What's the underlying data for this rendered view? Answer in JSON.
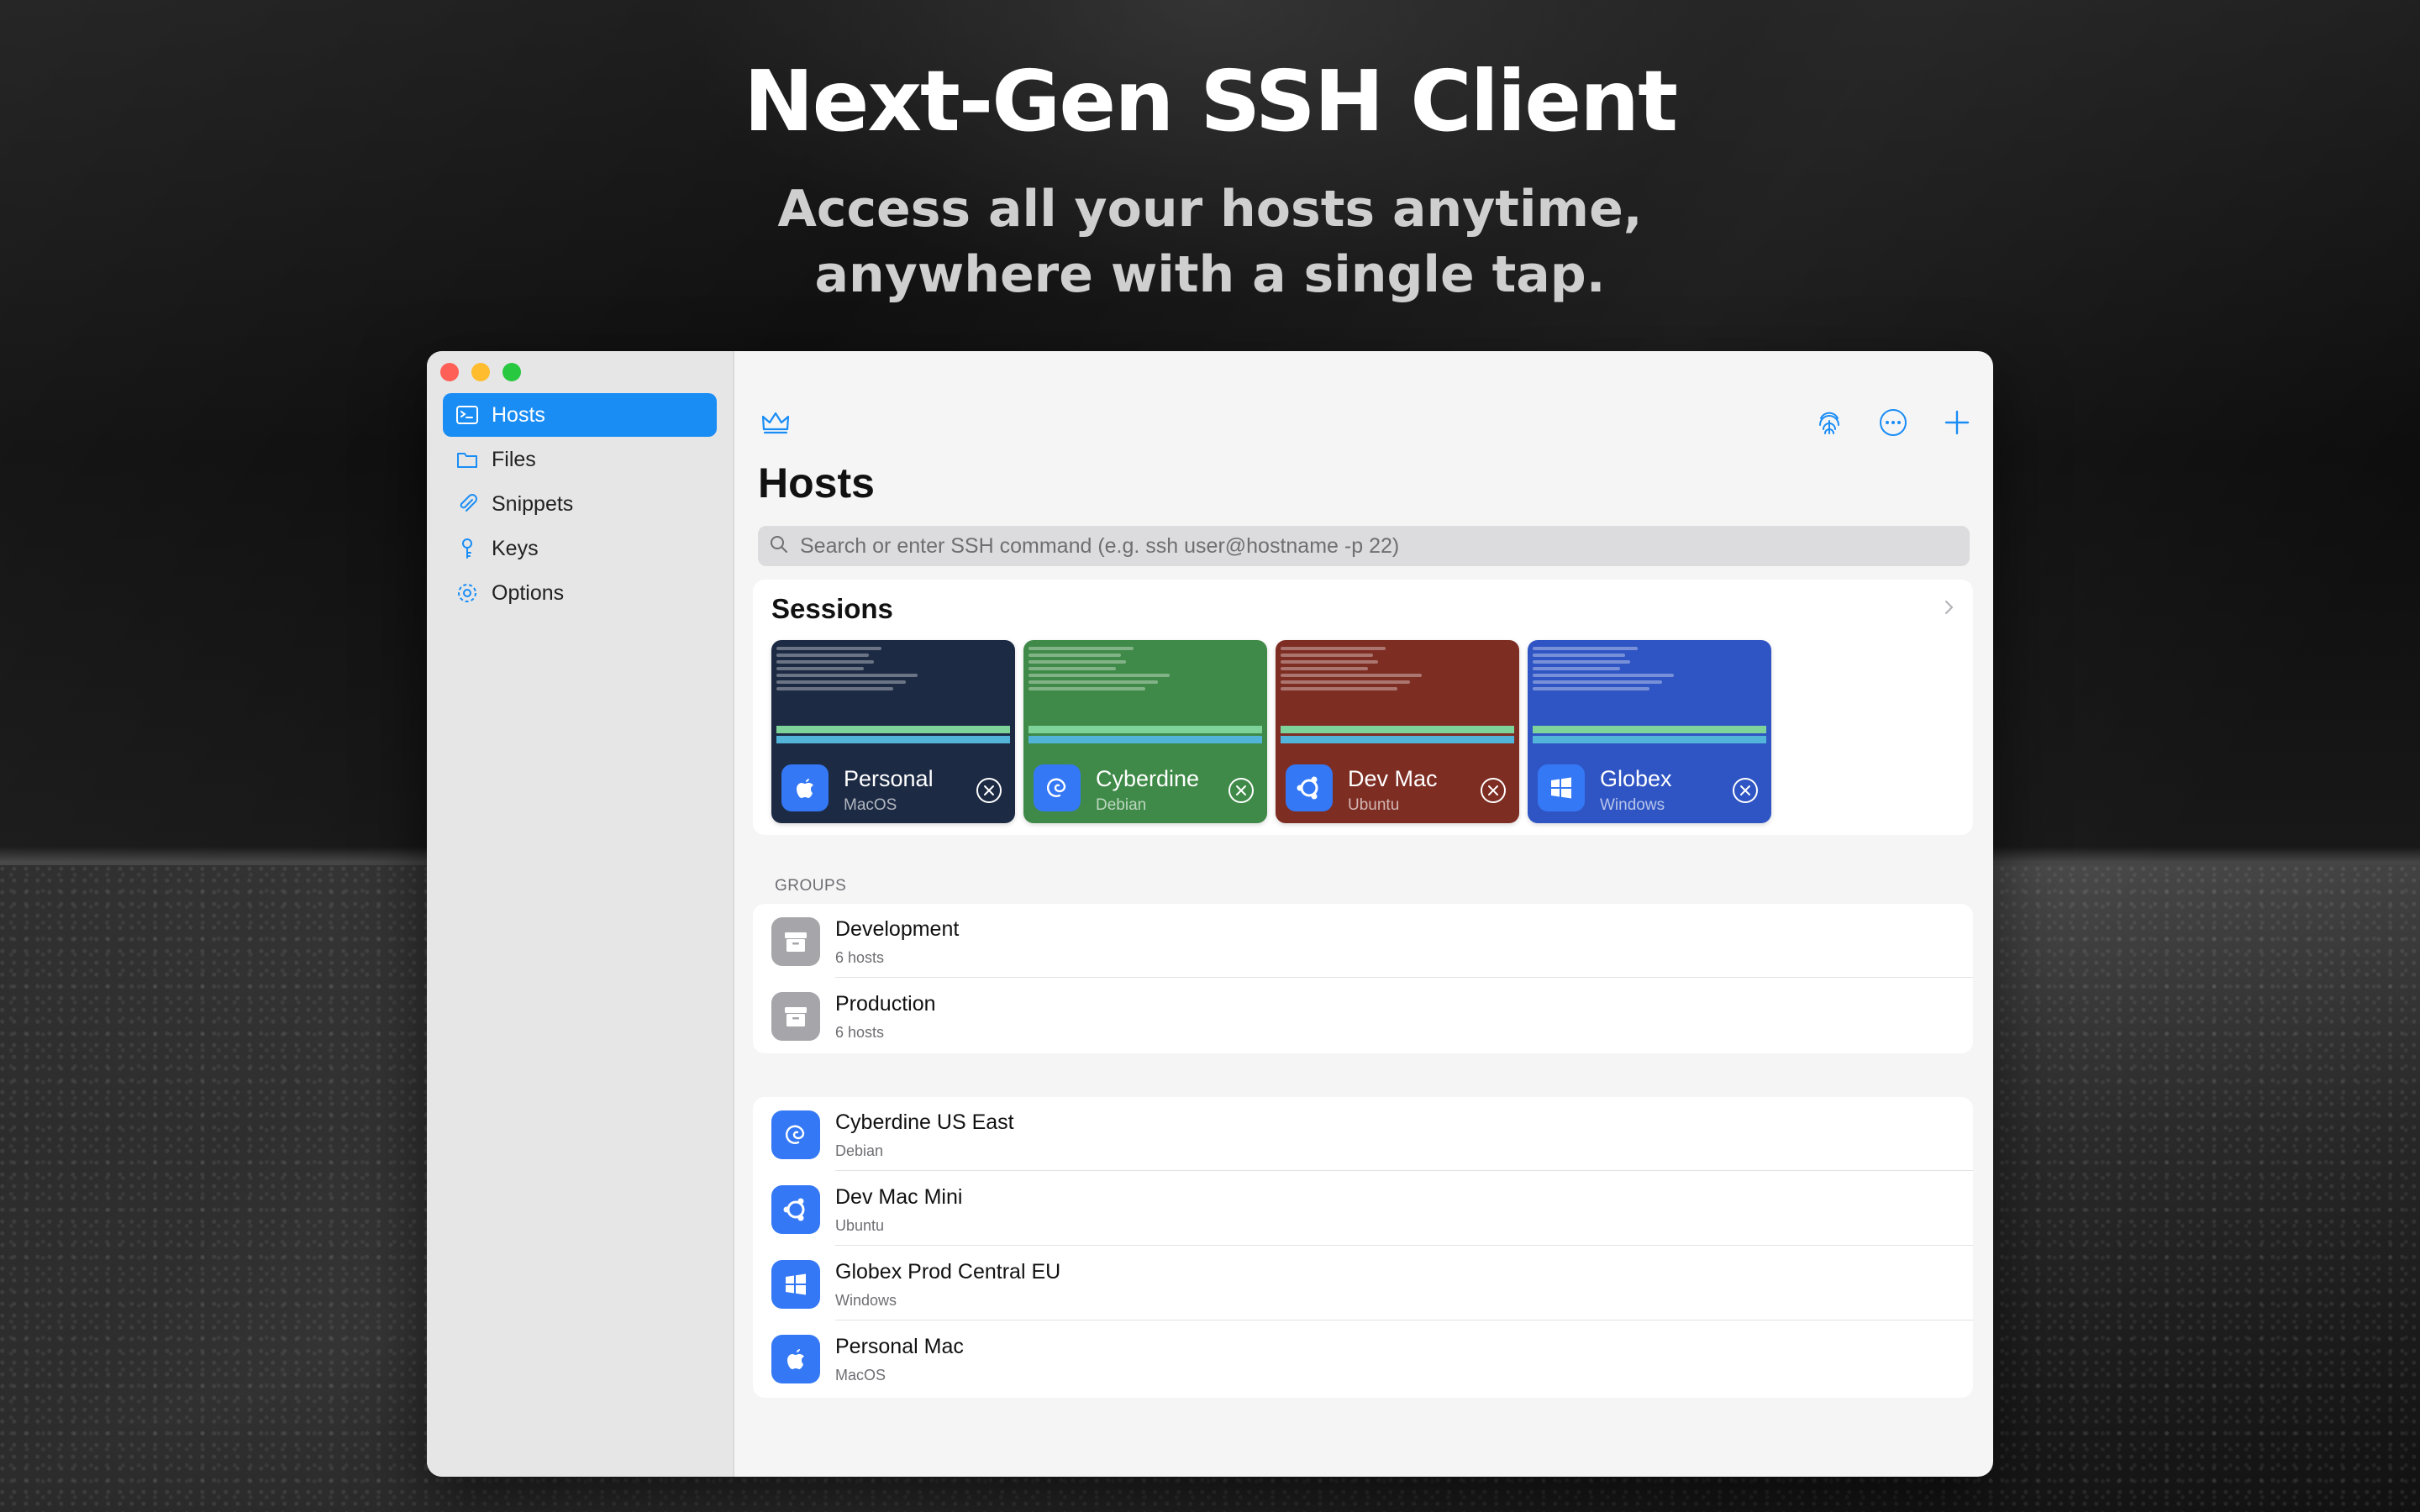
{
  "marketing": {
    "headline": "Next-Gen SSH Client",
    "subline_1": "Access all your hosts anytime,",
    "subline_2": "anywhere with a single tap."
  },
  "sidebar": {
    "items": [
      {
        "label": "Hosts",
        "icon": "terminal-icon",
        "active": true
      },
      {
        "label": "Files",
        "icon": "folder-icon"
      },
      {
        "label": "Snippets",
        "icon": "paperclip-icon"
      },
      {
        "label": "Keys",
        "icon": "key-icon"
      },
      {
        "label": "Options",
        "icon": "gear-icon"
      }
    ]
  },
  "toolbar": {
    "left_icon": "crown-icon",
    "right_icons": [
      "fingerprint-icon",
      "more-icon",
      "plus-icon"
    ]
  },
  "page_title": "Hosts",
  "search": {
    "placeholder": "Search or enter SSH command (e.g. ssh user@hostname -p 22)",
    "value": ""
  },
  "sessions": {
    "title": "Sessions",
    "items": [
      {
        "name": "Personal",
        "os": "MacOS",
        "color": "#1c2a44",
        "icon": "apple-icon"
      },
      {
        "name": "Cyberdine",
        "os": "Debian",
        "color": "#3f8a48",
        "icon": "debian-icon"
      },
      {
        "name": "Dev Mac",
        "os": "Ubuntu",
        "color": "#7e2d23",
        "icon": "ubuntu-icon"
      },
      {
        "name": "Globex",
        "os": "Windows",
        "color": "#2f55c4",
        "icon": "windows-icon"
      }
    ]
  },
  "groups": {
    "label": "GROUPS",
    "items": [
      {
        "name": "Development",
        "count": "6 hosts",
        "icon": "archive-icon"
      },
      {
        "name": "Production",
        "count": "6 hosts",
        "icon": "archive-icon"
      }
    ]
  },
  "hosts": {
    "items": [
      {
        "name": "Cyberdine US East",
        "os": "Debian",
        "icon": "debian-icon"
      },
      {
        "name": "Dev Mac Mini",
        "os": "Ubuntu",
        "icon": "ubuntu-icon"
      },
      {
        "name": "Globex Prod Central EU",
        "os": "Windows",
        "icon": "windows-icon"
      },
      {
        "name": "Personal Mac",
        "os": "MacOS",
        "icon": "apple-icon"
      }
    ]
  },
  "colors": {
    "accent": "#1a8df5",
    "os_icon_bg": "#3478f6"
  }
}
